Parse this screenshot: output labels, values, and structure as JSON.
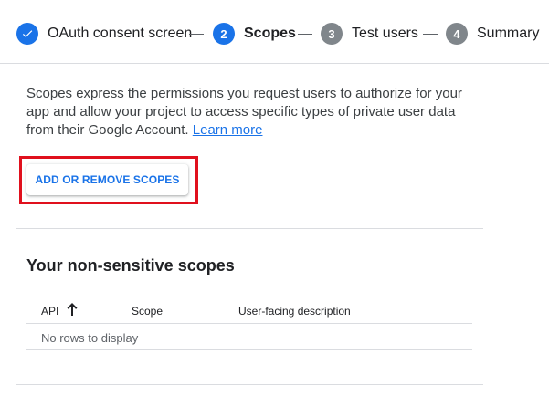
{
  "stepper": {
    "steps": [
      {
        "number": "",
        "label": "OAuth consent screen",
        "state": "done"
      },
      {
        "number": "2",
        "label": "Scopes",
        "state": "active"
      },
      {
        "number": "3",
        "label": "Test users",
        "state": "todo"
      },
      {
        "number": "4",
        "label": "Summary",
        "state": "todo"
      }
    ]
  },
  "main": {
    "description": "Scopes express the permissions you request users to authorize for your app and allow your project to access specific types of private user data from their Google Account.",
    "learn_more": "Learn more",
    "add_button": "ADD OR REMOVE SCOPES",
    "section_title": "Your non-sensitive scopes",
    "table": {
      "columns": [
        "API",
        "Scope",
        "User-facing description"
      ],
      "empty_text": "No rows to display"
    }
  },
  "colors": {
    "accent": "#1a73e8",
    "highlight": "#e0101d",
    "inactive_step": "#80868b"
  }
}
